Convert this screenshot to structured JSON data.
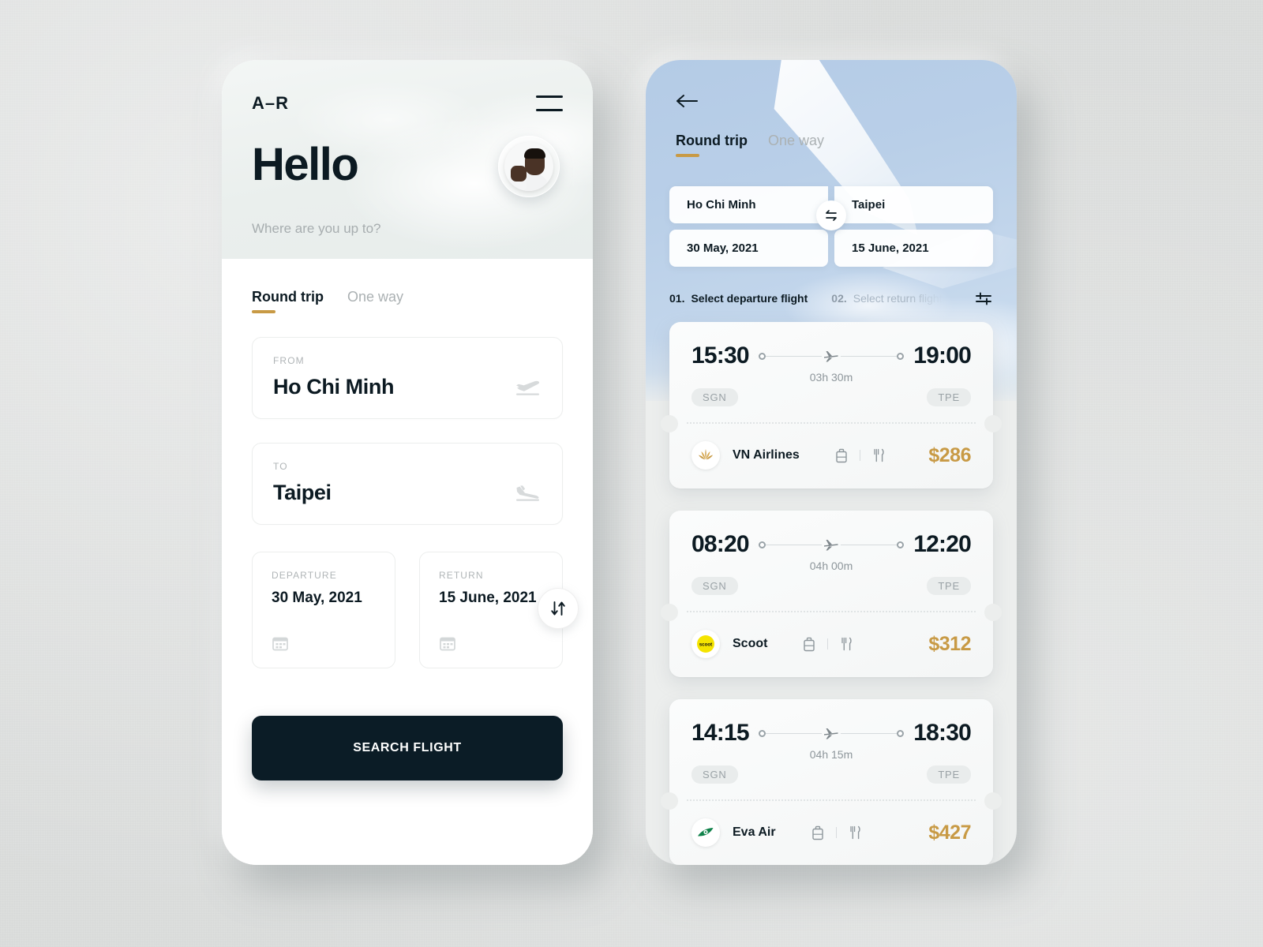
{
  "canvas": {
    "background_color": "#dcdedd"
  },
  "theme": {
    "accent_gold": "#c89a45",
    "dark": "#0b1c26",
    "muted": "#a7adaf"
  },
  "left_phone": {
    "logo": "A–R",
    "menu_icon": "hamburger-icon",
    "greeting": "Hello",
    "search_placeholder": "Where are you up to?",
    "tabs": [
      {
        "label": "Round trip",
        "active": true
      },
      {
        "label": "One way",
        "active": false
      }
    ],
    "from_field": {
      "label": "FROM",
      "value": "Ho Chi Minh",
      "icon": "plane-takeoff-icon"
    },
    "to_field": {
      "label": "TO",
      "value": "Taipei",
      "icon": "plane-landing-icon"
    },
    "swap_icon": "swap-vertical-icon",
    "departure_field": {
      "label": "DEPARTURE",
      "value": "30 May, 2021",
      "icon": "calendar-icon"
    },
    "return_field": {
      "label": "RETURN",
      "value": "15 June, 2021",
      "icon": "calendar-icon"
    },
    "search_button": "SEARCH FLIGHT"
  },
  "right_phone": {
    "back_icon": "arrow-left-icon",
    "tabs": [
      {
        "label": "Round trip",
        "active": true
      },
      {
        "label": "One way",
        "active": false
      }
    ],
    "origin": "Ho Chi Minh",
    "destination": "Taipei",
    "swap_icon": "swap-horizontal-icon",
    "departure_date": "30 May, 2021",
    "return_date": "15 June, 2021",
    "steps": [
      {
        "number": "01.",
        "label": "Select departure flight",
        "active": true
      },
      {
        "number": "02.",
        "label": "Select return flight",
        "active": false
      }
    ],
    "filter_icon": "filter-sliders-icon",
    "flights": [
      {
        "depart_time": "15:30",
        "arrive_time": "19:00",
        "duration": "03h 30m",
        "origin_code": "SGN",
        "destination_code": "TPE",
        "airline": "VN Airlines",
        "airline_logo": "vietnam-airlines-lotus-icon",
        "amenities": [
          "baggage-icon",
          "meal-icon"
        ],
        "price": "$286"
      },
      {
        "depart_time": "08:20",
        "arrive_time": "12:20",
        "duration": "04h 00m",
        "origin_code": "SGN",
        "destination_code": "TPE",
        "airline": "Scoot",
        "airline_logo": "scoot-icon",
        "amenities": [
          "baggage-icon",
          "meal-icon"
        ],
        "price": "$312"
      },
      {
        "depart_time": "14:15",
        "arrive_time": "18:30",
        "duration": "04h 15m",
        "origin_code": "SGN",
        "destination_code": "TPE",
        "airline": "Eva Air",
        "airline_logo": "eva-air-icon",
        "amenities": [
          "baggage-icon",
          "meal-icon"
        ],
        "price": "$427"
      }
    ]
  }
}
